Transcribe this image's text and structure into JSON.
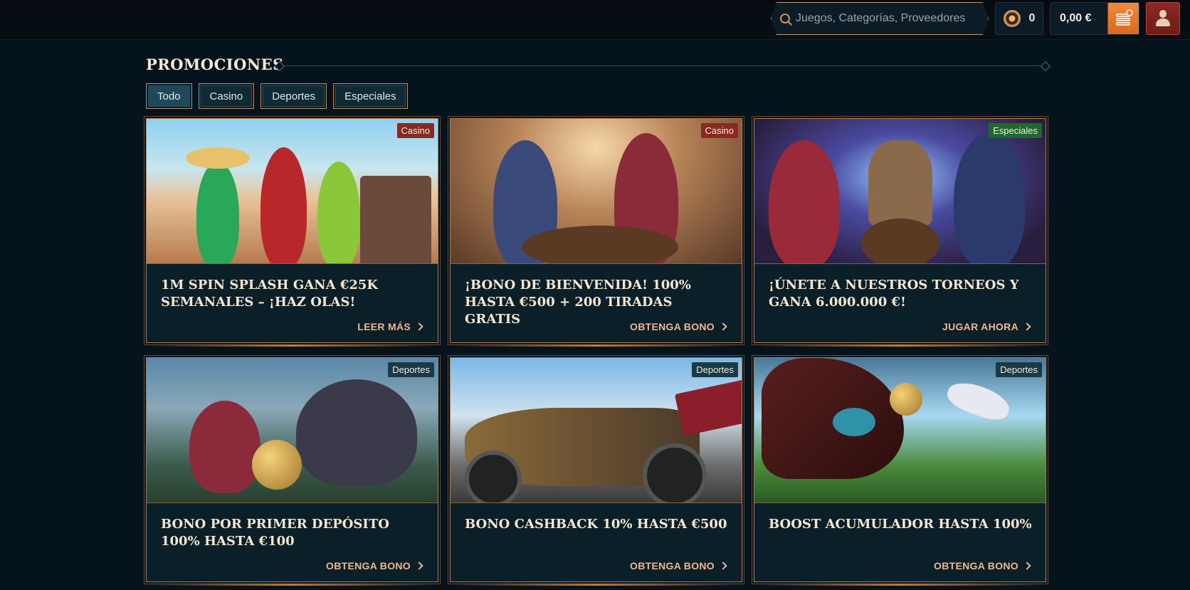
{
  "header": {
    "search_placeholder": "Juegos, Categorías, Proveedores",
    "coins": "0",
    "balance": "0,00 €"
  },
  "page": {
    "title": "PROMOCIONES"
  },
  "tabs": [
    {
      "label": "Todo",
      "active": true
    },
    {
      "label": "Casino",
      "active": false
    },
    {
      "label": "Deportes",
      "active": false
    },
    {
      "label": "Especiales",
      "active": false
    }
  ],
  "colors": {
    "casino_badge": "#8a2a1e",
    "especiales_badge": "#1e6a2e",
    "deportes_badge": "#1a3a44",
    "accent": "#f0b690"
  },
  "promotions": [
    {
      "badge": "Casino",
      "title": "1M Spin Splash gana €25K semanales – ¡Haz olas!",
      "cta": "LEER MÁS"
    },
    {
      "badge": "Casino",
      "title": "¡Bono de bienvenida! 100% hasta €500 + 200 tiradas gratis",
      "cta": "OBTENGA BONO"
    },
    {
      "badge": "Especiales",
      "title": "¡Únete a nuestros torneos y gana 6.000.000 €!",
      "cta": "JUGAR AHORA"
    },
    {
      "badge": "Deportes",
      "title": "Bono por primer depósito 100% hasta €100",
      "cta": "OBTENGA BONO"
    },
    {
      "badge": "Deportes",
      "title": "Bono cashback 10% hasta €500",
      "cta": "OBTENGA BONO"
    },
    {
      "badge": "Deportes",
      "title": "Boost acumulador hasta 100%",
      "cta": "OBTENGA BONO"
    }
  ]
}
